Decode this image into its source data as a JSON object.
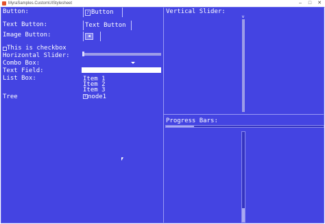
{
  "window": {
    "title": "MyraSamples.CustomUIStylesheet",
    "minimize_glyph": "–",
    "restore_glyph": "□",
    "close_glyph": "✕"
  },
  "left_panel": {
    "button_label": "Button:",
    "button_text": "Button",
    "text_button_label": "Text Button:",
    "text_button_text": "Text Button",
    "image_button_label": "Image Button:",
    "checkbox_text": "This is checkbox",
    "checkbox_checked": false,
    "hslider_label": "Horizontal Slider:",
    "hslider_value": 0,
    "combo_label": "Combo Box:",
    "combo_value": "",
    "textfield_label": "Text Field:",
    "textfield_value": "",
    "listbox_label": "List Box:",
    "list_items": [
      "Item 1",
      "Item 2",
      "Item 3"
    ],
    "tree_label": "Tree",
    "tree_node": "node1",
    "tree_toggle_glyph": "+"
  },
  "right_panel": {
    "vslider_label": "Vertical Slider:",
    "vslider_value": 0,
    "progress_label": "Progress Bars:",
    "hprogress_value": 0.18,
    "vprogress_value": 0.15
  },
  "icons": {
    "button_icon": "music-note-icon",
    "image_button_icon": "speaker-icon"
  },
  "colors": {
    "background": "#4444e2",
    "text": "#ffffff",
    "accent": "#a9a9f2"
  }
}
